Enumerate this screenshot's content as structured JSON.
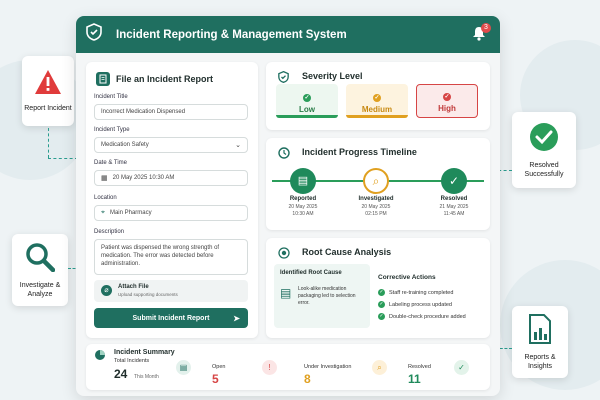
{
  "header": {
    "title": "Incident Reporting & Management System",
    "notifications": "3"
  },
  "side_cards": {
    "report": "Report Incident",
    "investigate": "Investigate & Analyze",
    "resolved": "Resolved Successfully",
    "reports": "Reports & Insights"
  },
  "form": {
    "title": "File an Incident Report",
    "incident_title_label": "Incident Title",
    "incident_title_value": "Incorrect Medication Dispensed",
    "type_label": "Incident Type",
    "type_value": "Medication Safety",
    "datetime_label": "Date & Time",
    "datetime_value": "20 May 2025  10:30 AM",
    "location_label": "Location",
    "location_value": "Main Pharmacy",
    "description_label": "Description",
    "description_value": "Patient was dispensed the wrong strength of medication. The error was detected before administration.",
    "attach_title": "Attach File",
    "attach_sub": "Upload supporting documents",
    "submit_label": "Submit Incident Report"
  },
  "severity": {
    "title": "Severity Level",
    "levels": [
      {
        "label": "Low",
        "color": "#2a9d5a"
      },
      {
        "label": "Medium",
        "color": "#e0a020"
      },
      {
        "label": "High",
        "color": "#d64545"
      }
    ]
  },
  "timeline": {
    "title": "Incident Progress Timeline",
    "steps": [
      {
        "label": "Reported",
        "date": "20 May 2025",
        "time": "10:30 AM"
      },
      {
        "label": "Investigated",
        "date": "20 May 2025",
        "time": "02:15 PM"
      },
      {
        "label": "Resolved",
        "date": "21 May 2025",
        "time": "11:45 AM"
      }
    ]
  },
  "rca": {
    "title": "Root Cause Analysis",
    "identified_title": "Identified Root Cause",
    "identified_text": "Look-alike medication packaging led to selection error.",
    "corrective_title": "Corrective Actions",
    "actions": [
      "Staff re-training completed",
      "Labeling process updated",
      "Double-check procedure added"
    ]
  },
  "summary": {
    "title": "Incident Summary",
    "total_label": "Total Incidents",
    "total_value": "24",
    "total_sub": "This Month",
    "open_label": "Open",
    "open_value": "5",
    "inv_label": "Under Investigation",
    "inv_value": "8",
    "resolved_label": "Resolved",
    "resolved_value": "11"
  }
}
